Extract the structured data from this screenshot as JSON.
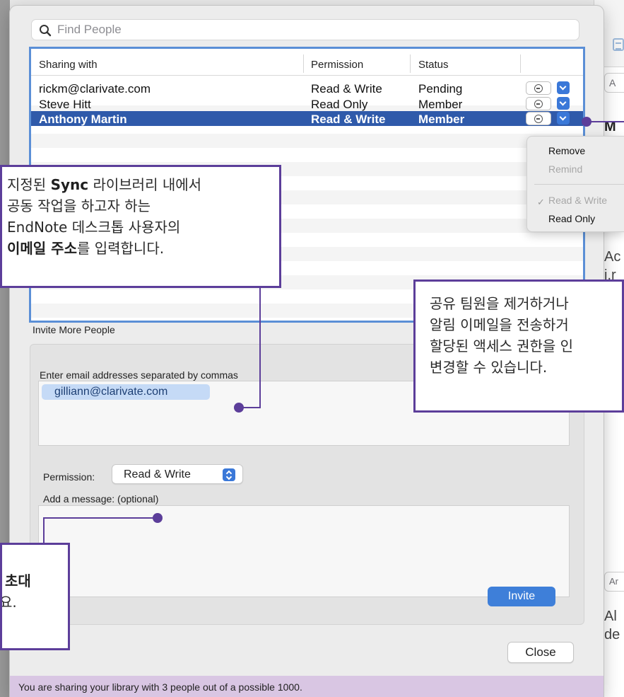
{
  "search": {
    "placeholder": "Find People"
  },
  "table": {
    "columns": [
      "Sharing with",
      "Permission",
      "Status"
    ],
    "rows": [
      {
        "name": "rickm@clarivate.com",
        "permission": "Read & Write",
        "status": "Pending",
        "selected": false
      },
      {
        "name": "Steve Hitt",
        "permission": "Read Only",
        "status": "Member",
        "selected": false
      },
      {
        "name": "Anthony Martin",
        "permission": "Read & Write",
        "status": "Member",
        "selected": true
      }
    ]
  },
  "menu": {
    "items": [
      {
        "label": "Remove",
        "enabled": true
      },
      {
        "label": "Remind",
        "enabled": false
      },
      {
        "label": "Read & Write",
        "enabled": false,
        "checked": true
      },
      {
        "label": "Read Only",
        "enabled": true
      }
    ],
    "check_mark": "✓"
  },
  "invite": {
    "section_title": "Invite More People",
    "email_label": "Enter email addresses separated by commas",
    "email_token": "gilliann@clarivate.com",
    "permission_label": "Permission:",
    "permission_value": "Read & Write",
    "message_label": "Add a message: (optional)",
    "invite_button": "Invite"
  },
  "close_button": "Close",
  "status_text": "You are sharing your library with 3 people out of a possible 1000.",
  "background_window": {
    "field_a": "A",
    "heading": "M",
    "text_a1": "Ac",
    "text_a2": "j.r",
    "field_b": "Ar",
    "text_b1": "Al",
    "text_b2": "de"
  },
  "callouts": {
    "email": {
      "l1_a": "지정된 ",
      "l1_b": "Sync",
      "l1_c": " 라이브러리 내에서",
      "l2": "공동 작업을 하고자 하는",
      "l3": "EndNote 데스크톱 사용자의",
      "l4_a": "이메일 주소",
      "l4_b": "를 입력합니다."
    },
    "team": {
      "l1": "공유 팀원을 제거하거나",
      "l2": "알림 이메일을 전송하거",
      "l3": "할당된 액세스 권한을 인",
      "l4": "변경할 수 있습니다."
    },
    "invite": {
      "l1": "초대",
      "l2": "요."
    }
  },
  "colors": {
    "accent_blue": "#3e7fd9",
    "selection": "#2f5aaa",
    "callout_border": "#5c3e9a",
    "status_bar": "#d9c6e3"
  }
}
